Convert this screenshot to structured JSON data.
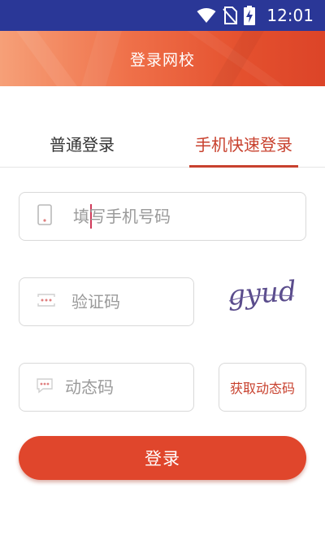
{
  "status_bar": {
    "time": "12:01",
    "icons": [
      "wifi-icon",
      "no-sim-icon",
      "battery-charging-icon"
    ]
  },
  "header": {
    "title": "登录网校"
  },
  "tabs": [
    {
      "label": "普通登录",
      "active": false
    },
    {
      "label": "手机快速登录",
      "active": true
    }
  ],
  "form": {
    "phone": {
      "placeholder": "填写手机号码",
      "value": "",
      "icon": "phone-icon"
    },
    "captcha": {
      "placeholder": "验证码",
      "value": "",
      "icon": "dots-icon",
      "image_text": "gyud"
    },
    "dynamic_code": {
      "placeholder": "动态码",
      "value": "",
      "icon": "message-icon"
    },
    "get_code_label": "获取动态码"
  },
  "login_label": "登录",
  "colors": {
    "accent": "#e0462c",
    "tab_active": "#c8412e",
    "status_bar": "#2a3797"
  }
}
